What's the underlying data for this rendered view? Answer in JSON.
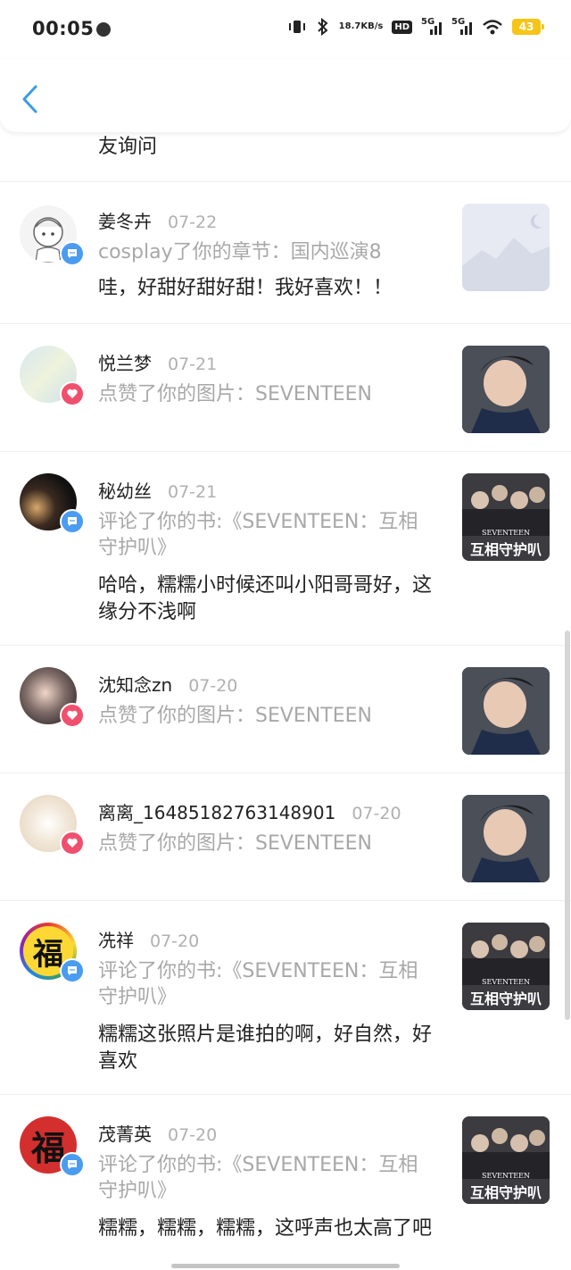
{
  "status_bar": {
    "time": "00:05",
    "speed_value": "18.7",
    "speed_unit": "KB/s",
    "hd_label": "HD",
    "sim1_label": "5G",
    "sim2_label": "5G",
    "battery": "43"
  },
  "nav": {
    "back_icon": "chevron-left-icon"
  },
  "top_partial_text": "友询问",
  "notifications": [
    {
      "name": "姜冬卉",
      "date": "07-22",
      "type": "comment",
      "action": "cosplay了你的章节：国内巡演8",
      "content": "哇，好甜好甜好甜！我好喜欢！！",
      "thumb": "placeholder"
    },
    {
      "name": "悦兰梦",
      "date": "07-21",
      "type": "like",
      "action": "点赞了你的图片：SEVENTEEN",
      "content": "",
      "thumb": "portrait"
    },
    {
      "name": "秘幼丝",
      "date": "07-21",
      "type": "comment",
      "action": "评论了你的书:《SEVENTEEN：互相守护叭》",
      "content": "哈哈，糯糯小时候还叫小阳哥哥好，这缘分不浅啊",
      "thumb": "book",
      "thumb_text": "互相守护叭",
      "thumb_band": "SEVENTEEN"
    },
    {
      "name": "沈知念zn",
      "date": "07-20",
      "type": "like",
      "action": "点赞了你的图片：SEVENTEEN",
      "content": "",
      "thumb": "portrait"
    },
    {
      "name": "离离_16485182763148901",
      "date": "07-20",
      "type": "like",
      "action": "点赞了你的图片：SEVENTEEN",
      "content": "",
      "thumb": "portrait"
    },
    {
      "name": "冼祥",
      "date": "07-20",
      "type": "comment",
      "action": "评论了你的书:《SEVENTEEN：互相守护叭》",
      "content": "糯糯这张照片是谁拍的啊，好自然，好喜欢",
      "thumb": "book",
      "thumb_text": "互相守护叭",
      "thumb_band": "SEVENTEEN",
      "avatar_char": "福"
    },
    {
      "name": "茂菁英",
      "date": "07-20",
      "type": "comment",
      "action": "评论了你的书:《SEVENTEEN：互相守护叭》",
      "content": "糯糯，糯糯，糯糯，这呼声也太高了吧",
      "thumb": "book",
      "thumb_text": "互相守护叭",
      "thumb_band": "SEVENTEEN",
      "avatar_char": "福"
    }
  ],
  "colors": {
    "comment_badge": "#4a9cf0",
    "like_badge": "#f0506e",
    "back_arrow": "#3a9be6"
  }
}
